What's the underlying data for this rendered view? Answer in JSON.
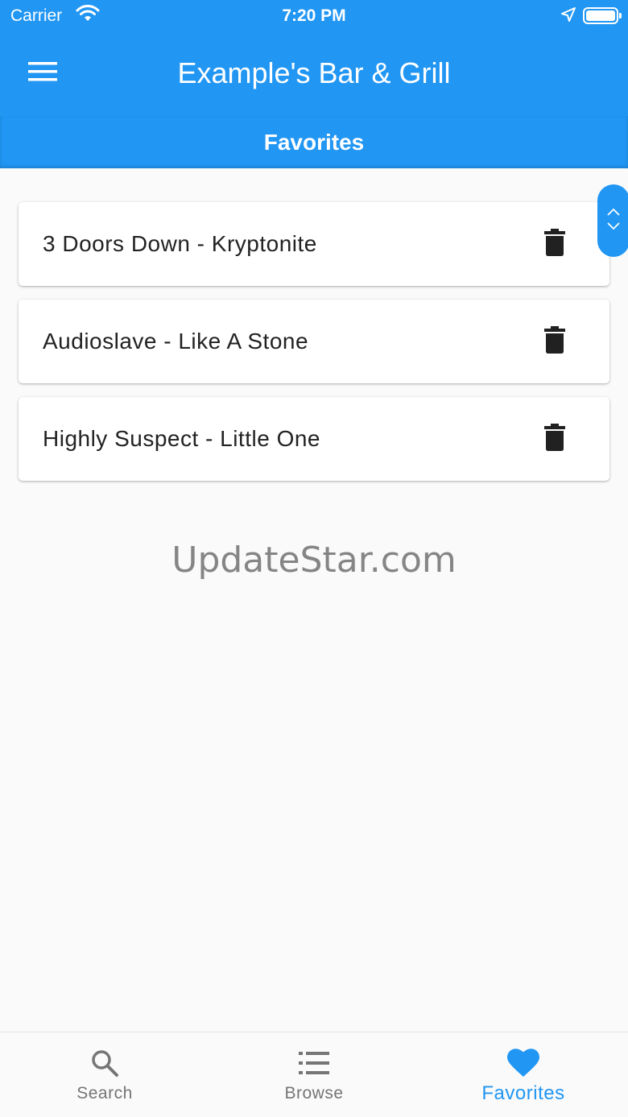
{
  "status_bar": {
    "carrier": "Carrier",
    "time": "7:20 PM"
  },
  "app_bar": {
    "title": "Example's Bar & Grill",
    "menu_icon": "hamburger-menu-icon"
  },
  "sub_bar": {
    "title": "Favorites"
  },
  "favorites": [
    {
      "label": "3 Doors Down - Kryptonite",
      "action_icon": "trash-icon"
    },
    {
      "label": "Audioslave - Like A Stone",
      "action_icon": "trash-icon"
    },
    {
      "label": "Highly Suspect - Little One",
      "action_icon": "trash-icon"
    }
  ],
  "watermark": "UpdateStar.com",
  "bottom_nav": {
    "items": [
      {
        "label": "Search",
        "icon": "search-icon",
        "active": false
      },
      {
        "label": "Browse",
        "icon": "list-icon",
        "active": false
      },
      {
        "label": "Favorites",
        "icon": "heart-icon",
        "active": true
      }
    ]
  },
  "colors": {
    "primary": "#2196f3",
    "background": "#fafafa",
    "inactive_nav": "#757575",
    "icon_dark": "#212121"
  }
}
